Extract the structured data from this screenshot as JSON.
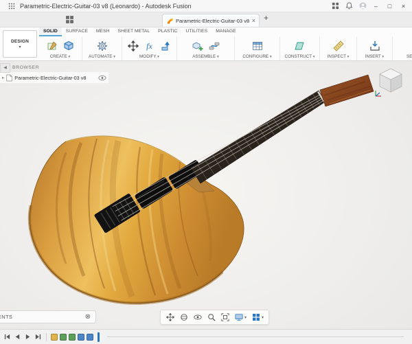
{
  "window": {
    "title": "Parametric-Electric-Guitar-03 v8 (Leonardo) - Autodesk Fusion"
  },
  "tabs": {
    "document": "Parametric-Electric-Guitar-03 v8"
  },
  "toolbar": {
    "workspace": "DESIGN",
    "tabs": [
      "SOLID",
      "SURFACE",
      "MESH",
      "SHEET METAL",
      "PLASTIC",
      "UTILITIES",
      "MANAGE"
    ],
    "active_tab": "SOLID",
    "groups": [
      {
        "label": "CREATE"
      },
      {
        "label": "AUTOMATE"
      },
      {
        "label": "MODIFY"
      },
      {
        "label": "ASSEMBLE"
      },
      {
        "label": "CONFIGURE"
      },
      {
        "label": "CONSTRUCT"
      },
      {
        "label": "INSPECT"
      },
      {
        "label": "INSERT"
      },
      {
        "label": "SELECT"
      }
    ],
    "fx_label": "fx"
  },
  "browser": {
    "title": "BROWSER",
    "document": "Parametric-Electric-Guitar-03 v8"
  },
  "comments": {
    "title": "COMMENTS"
  },
  "glyphs": {
    "caret": "▾",
    "plus": "+",
    "close": "×",
    "minimize": "–",
    "maximize": "□",
    "collapse_left": "◀",
    "expand": "▸",
    "cross_circle": "⊗"
  },
  "colors": {
    "accent_blue": "#0696d7",
    "tool_blue": "#2a76bc",
    "wood_body": "#d89a3e",
    "fretboard": "#2a231c",
    "headstock_wood": "#8a4a22"
  }
}
